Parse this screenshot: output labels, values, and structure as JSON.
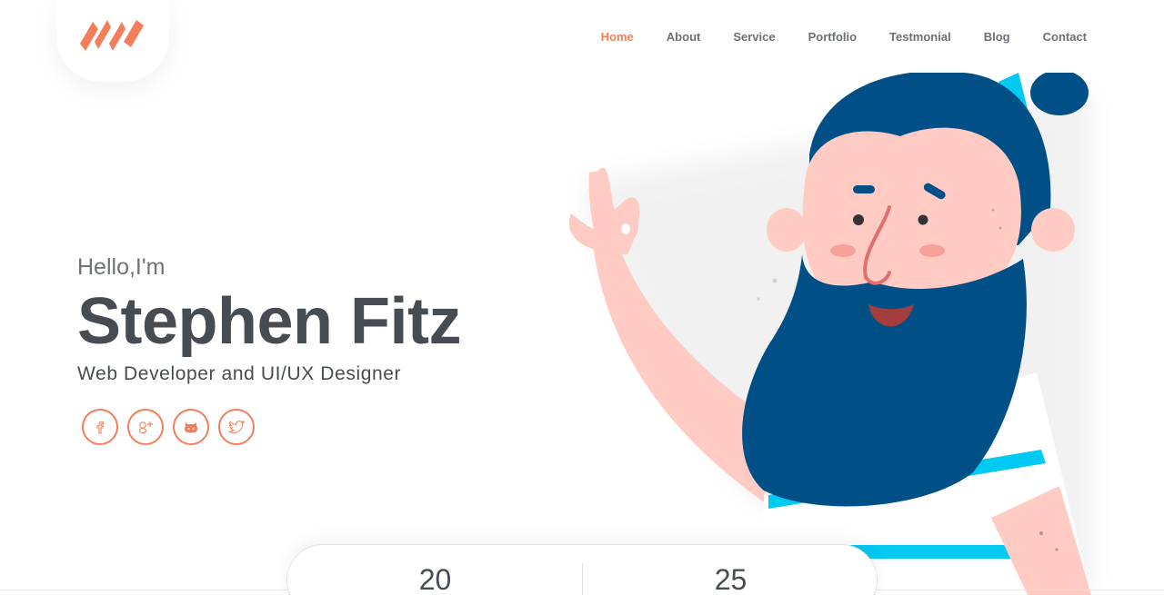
{
  "header": {
    "logo_icon": "stylized-m-logo-icon",
    "nav": [
      {
        "label": "Home",
        "active": true
      },
      {
        "label": "About",
        "active": false
      },
      {
        "label": "Service",
        "active": false
      },
      {
        "label": "Portfolio",
        "active": false
      },
      {
        "label": "Testmonial",
        "active": false
      },
      {
        "label": "Blog",
        "active": false
      },
      {
        "label": "Contact",
        "active": false
      }
    ]
  },
  "hero": {
    "greeting": "Hello,I'm",
    "name": "Stephen Fitz",
    "role": "Web Developer and UI/UX Designer",
    "socials": [
      {
        "icon": "facebook-icon"
      },
      {
        "icon": "google-plus-icon"
      },
      {
        "icon": "github-icon"
      },
      {
        "icon": "twitter-icon"
      }
    ],
    "illustration": "bearded-man-ok-hand-illustration"
  },
  "stats": [
    {
      "value": "20"
    },
    {
      "value": "25"
    }
  ],
  "colors": {
    "accent": "#f47e5a",
    "text_dark": "#474b52",
    "hair_blue": "#004f87",
    "skin": "#ffcbc3",
    "stripe_cyan": "#00c9f2"
  }
}
